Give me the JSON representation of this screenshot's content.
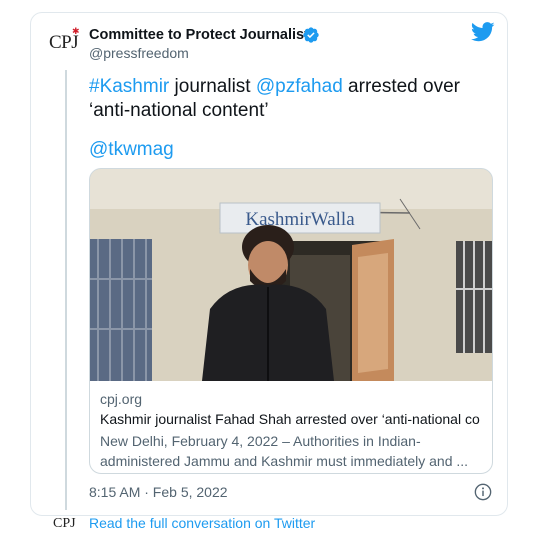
{
  "author": {
    "logo_text": "CPJ",
    "name": "Committee to Protect Journalists",
    "handle": "@pressfreedom",
    "verified": true
  },
  "tweet": {
    "hashtag": "#Kashmir",
    "text_1": " journalist ",
    "mention_1": "@pzfahad",
    "text_2": " arrested over ‘anti-national content’",
    "mention_2": "@tkwmag",
    "timestamp": "8:15 AM · Feb 5, 2022"
  },
  "link_card": {
    "image_sign_text": "KashmirWalla",
    "domain": "cpj.org",
    "title": "Kashmir journalist Fahad Shah arrested over ‘anti-national con...",
    "description": "New Delhi, February 4, 2022 – Authorities in Indian-administered Jammu and Kashmir must immediately and ..."
  },
  "footer": {
    "logo_text": "CPJ",
    "read_conversation": "Read the full conversation on Twitter"
  },
  "colors": {
    "link_blue": "#1d9bf0",
    "muted_text": "#536471",
    "cpj_red": "#d11f2b"
  },
  "icons": {
    "platform": "twitter-bird-icon",
    "verified": "verified-badge-icon",
    "info": "info-icon"
  }
}
